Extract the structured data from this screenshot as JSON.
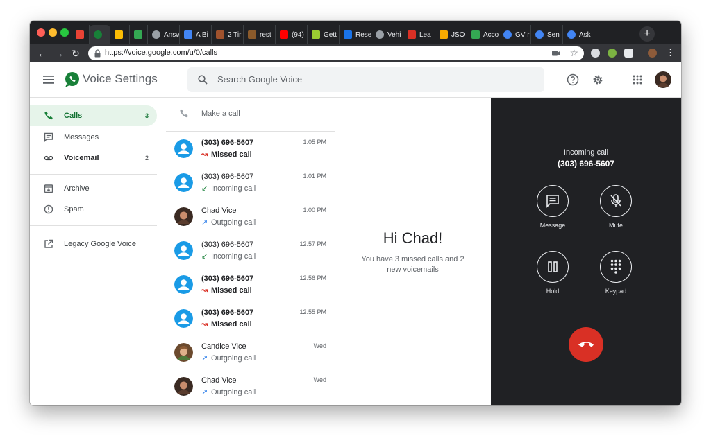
{
  "browser": {
    "tabs": [
      {
        "label": "",
        "color": "#ea4335"
      },
      {
        "label": "",
        "color": "#188038",
        "active": true
      },
      {
        "label": "",
        "color": "#fbbc04"
      },
      {
        "label": "",
        "color": "#34a853"
      },
      {
        "label": "Answ",
        "color": "#9aa0a6"
      },
      {
        "label": "A Bi",
        "color": "#4285f4"
      },
      {
        "label": "2 Tir",
        "color": "#a0522d"
      },
      {
        "label": "rest",
        "color": "#8b5a2b"
      },
      {
        "label": "(94)",
        "color": "#ff0000"
      },
      {
        "label": "Gett",
        "color": "#9acd32"
      },
      {
        "label": "Rese",
        "color": "#1a73e8"
      },
      {
        "label": "Vehi",
        "color": "#9aa0a6"
      },
      {
        "label": "Lea",
        "color": "#d93025"
      },
      {
        "label": "JSO",
        "color": "#f9ab00"
      },
      {
        "label": "Acco",
        "color": "#34a853"
      },
      {
        "label": "GV r",
        "color": "#4285f4"
      },
      {
        "label": "Sen",
        "color": "#4285f4"
      },
      {
        "label": "Ask",
        "color": "#4285f4"
      }
    ],
    "new_tab": "+",
    "url": "https://voice.google.com/u/0/calls"
  },
  "header": {
    "title": "Voice Settings",
    "search_placeholder": "Search Google Voice"
  },
  "sidebar": {
    "items": [
      {
        "label": "Calls",
        "count": "3"
      },
      {
        "label": "Messages",
        "count": ""
      },
      {
        "label": "Voicemail",
        "count": "2"
      },
      {
        "label": "Archive",
        "count": ""
      },
      {
        "label": "Spam",
        "count": ""
      },
      {
        "label": "Legacy Google Voice",
        "count": ""
      }
    ]
  },
  "calls": {
    "make_call_label": "Make a call",
    "items": [
      {
        "name": "(303) 696-5607",
        "status": "Missed call",
        "time": "1:05 PM"
      },
      {
        "name": "(303) 696-5607",
        "status": "Incoming call",
        "time": "1:01 PM"
      },
      {
        "name": "Chad Vice",
        "status": "Outgoing call",
        "time": "1:00 PM"
      },
      {
        "name": "(303) 696-5607",
        "status": "Incoming call",
        "time": "12:57 PM"
      },
      {
        "name": "(303) 696-5607",
        "status": "Missed call",
        "time": "12:56 PM"
      },
      {
        "name": "(303) 696-5607",
        "status": "Missed call",
        "time": "12:55 PM"
      },
      {
        "name": "Candice Vice",
        "status": "Outgoing call",
        "time": "Wed"
      },
      {
        "name": "Chad Vice",
        "status": "Outgoing call",
        "time": "Wed"
      }
    ]
  },
  "welcome": {
    "greeting": "Hi Chad!",
    "summary": "You have 3 missed calls and 2 new voicemails"
  },
  "incoming_call": {
    "title": "Incoming call",
    "number": "(303) 696-5607",
    "buttons": [
      {
        "label": "Message",
        "icon": "message-icon"
      },
      {
        "label": "Mute",
        "icon": "mic-off-icon"
      },
      {
        "label": "Hold",
        "icon": "pause-icon"
      },
      {
        "label": "Keypad",
        "icon": "dialpad-icon"
      }
    ],
    "hangup_icon": "call-end-icon"
  },
  "colors": {
    "accent_green": "#188038",
    "missed_red": "#d93025",
    "panel_dark": "#202124",
    "avatar_blue": "#1a9be6"
  }
}
